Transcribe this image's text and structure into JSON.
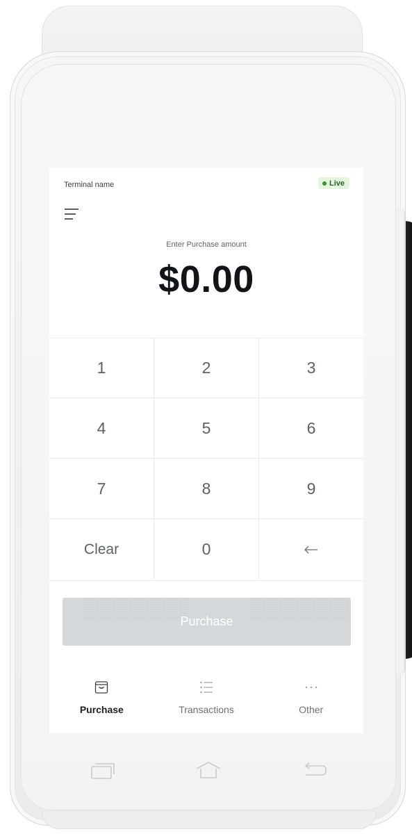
{
  "header": {
    "terminal_name": "Terminal name",
    "status_badge": "Live"
  },
  "amount": {
    "label": "Enter Purchase amount",
    "value": "$0.00"
  },
  "keypad": {
    "keys": [
      "1",
      "2",
      "3",
      "4",
      "5",
      "6",
      "7",
      "8",
      "9",
      "Clear",
      "0"
    ]
  },
  "purchase_button": {
    "label": "Purchase"
  },
  "bottom_nav": {
    "items": [
      {
        "label": "Purchase",
        "icon": "bag-icon",
        "active": true
      },
      {
        "label": "Transactions",
        "icon": "list-icon",
        "active": false
      },
      {
        "label": "Other",
        "icon": "more-icon",
        "active": false
      }
    ]
  },
  "colors": {
    "live_badge_bg": "#e3f5dc",
    "live_badge_text": "#2e5d2a",
    "button_disabled": "#d5d8db",
    "amount_text": "#111418"
  }
}
